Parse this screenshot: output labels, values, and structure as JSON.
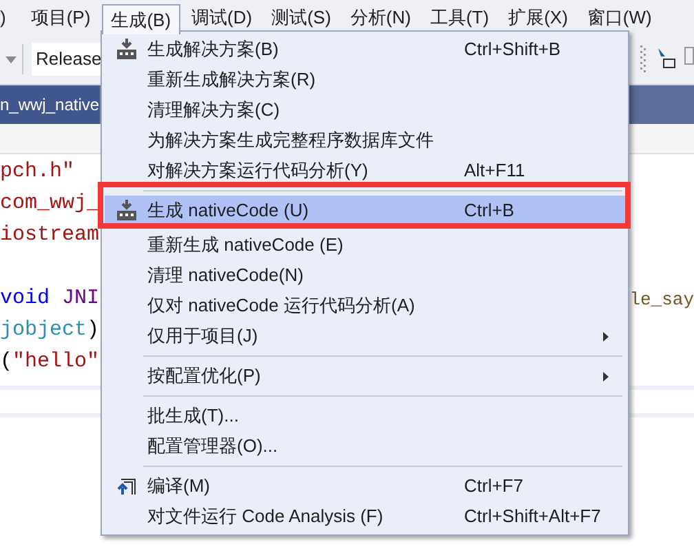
{
  "menubar": [
    {
      "label": ")",
      "selected": false
    },
    {
      "label": "项目(P)",
      "selected": false
    },
    {
      "label": "生成(B)",
      "selected": true
    },
    {
      "label": "调试(D)",
      "selected": false
    },
    {
      "label": "测试(S)",
      "selected": false
    },
    {
      "label": "分析(N)",
      "selected": false
    },
    {
      "label": "工具(T)",
      "selected": false
    },
    {
      "label": "扩展(X)",
      "selected": false
    },
    {
      "label": "窗口(W)",
      "selected": false
    }
  ],
  "toolbar": {
    "configuration": "Release"
  },
  "document_tab": {
    "title": "n_wwj_native"
  },
  "editor": {
    "lines": [
      {
        "kind": "code",
        "left": [
          {
            "text": "pch.h\"",
            "kind": "string"
          }
        ]
      },
      {
        "kind": "code",
        "left": [
          {
            "text": "com_wwj_",
            "kind": "string"
          }
        ]
      },
      {
        "kind": "code",
        "left": [
          {
            "text": "iostream",
            "kind": "string"
          }
        ]
      },
      {
        "kind": "blank"
      },
      {
        "kind": "code",
        "left": [
          {
            "text": "void",
            "kind": "keyword",
            "space_after": true
          },
          {
            "text": "JNI",
            "kind": "macro"
          }
        ],
        "right": [
          {
            "text": "le_say",
            "kind": "identifier"
          }
        ]
      },
      {
        "kind": "code",
        "left": [
          {
            "text": "jobject",
            "kind": "type"
          },
          {
            "text": ")",
            "kind": "plain"
          }
        ]
      },
      {
        "kind": "code",
        "left": [
          {
            "text": "(",
            "kind": "plain"
          },
          {
            "text": "\"hello\"",
            "kind": "string"
          }
        ]
      }
    ]
  },
  "menu": {
    "items": [
      {
        "kind": "build",
        "label": "生成解决方案(B)",
        "shortcut": "Ctrl+Shift+B",
        "selected": false
      },
      {
        "kind": "item",
        "label": "重新生成解决方案(R)",
        "selected": false
      },
      {
        "kind": "item",
        "label": "清理解决方案(C)",
        "selected": false
      },
      {
        "kind": "item",
        "label": "为解决方案生成完整程序数据库文件",
        "selected": false
      },
      {
        "kind": "item",
        "label": "对解决方案运行代码分析(Y)",
        "shortcut": "Alt+F11",
        "selected": false
      },
      {
        "kind": "separator"
      },
      {
        "kind": "build",
        "label": "生成 nativeCode (U)",
        "shortcut": "Ctrl+B",
        "selected": true
      },
      {
        "kind": "item",
        "label": "重新生成 nativeCode (E)",
        "selected": false
      },
      {
        "kind": "item",
        "label": "清理 nativeCode(N)",
        "selected": false
      },
      {
        "kind": "item",
        "label": "仅对 nativeCode 运行代码分析(A)",
        "selected": false
      },
      {
        "kind": "item",
        "label": "仅用于项目(J)",
        "submenu": true,
        "selected": false
      },
      {
        "kind": "separator"
      },
      {
        "kind": "item",
        "label": "按配置优化(P)",
        "submenu": true,
        "selected": false
      },
      {
        "kind": "separator"
      },
      {
        "kind": "item",
        "label": "批生成(T)...",
        "selected": false
      },
      {
        "kind": "item",
        "label": "配置管理器(O)...",
        "selected": false
      },
      {
        "kind": "separator"
      },
      {
        "kind": "compile",
        "label": "编译(M)",
        "shortcut": "Ctrl+F7",
        "selected": false
      },
      {
        "kind": "item",
        "label": "对文件运行 Code Analysis (F)",
        "shortcut": "Ctrl+Shift+Alt+F7",
        "selected": false
      }
    ]
  }
}
